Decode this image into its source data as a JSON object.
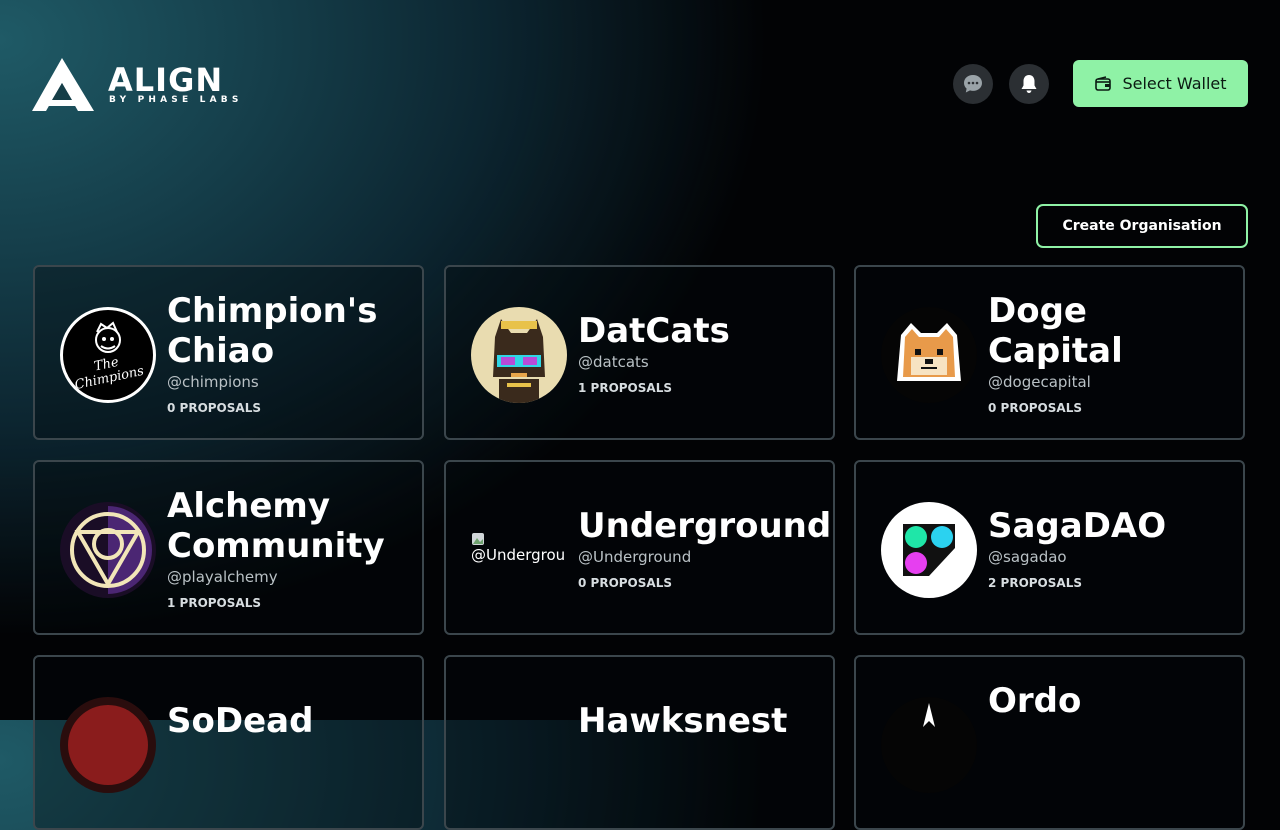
{
  "header": {
    "logo_word": "ALIGN",
    "logo_sub": "BY PHASE LABS",
    "wallet_label": "Select Wallet",
    "icons": [
      "chat-icon",
      "bell-icon",
      "wallet-icon"
    ]
  },
  "actions": {
    "create_label": "Create Organisation"
  },
  "colors": {
    "accent": "#8ff2a6",
    "card_border": "#3b464c"
  },
  "orgs": [
    {
      "name": "Chimpion's\nChiao",
      "handle": "@chimpions",
      "proposals": "0 PROPOSALS",
      "avatar_text": "The Chimpions"
    },
    {
      "name": "DatCats",
      "handle": "@datcats",
      "proposals": "1 PROPOSALS"
    },
    {
      "name": "Doge\nCapital",
      "handle": "@dogecapital",
      "proposals": "0 PROPOSALS"
    },
    {
      "name": "Alchemy\nCommunity",
      "handle": "@playalchemy",
      "proposals": "1 PROPOSALS"
    },
    {
      "name": "Underground",
      "handle": "@Underground",
      "proposals": "0 PROPOSALS",
      "avatar_alt": "@Undergrou"
    },
    {
      "name": "SagaDAO",
      "handle": "@sagadao",
      "proposals": "2 PROPOSALS"
    },
    {
      "name": "SoDead"
    },
    {
      "name": "Hawksnest"
    },
    {
      "name": "Ordo"
    }
  ]
}
